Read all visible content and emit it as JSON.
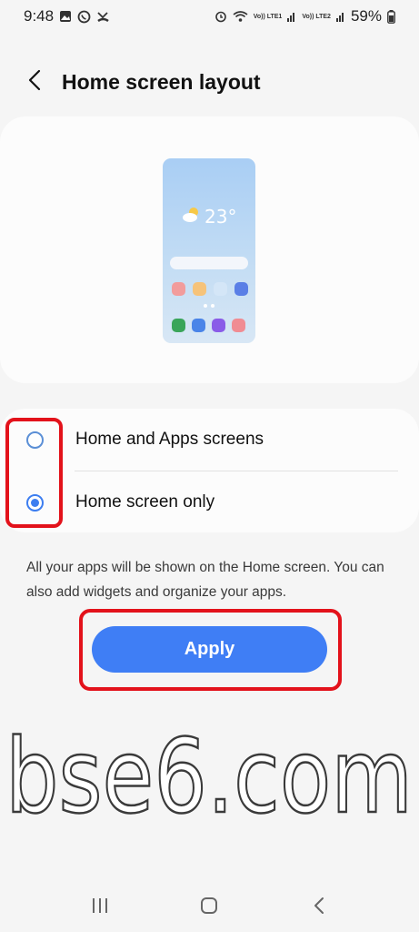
{
  "status_bar": {
    "time": "9:48",
    "battery": "59%",
    "sim1": "Vo)) LTE1",
    "sim2": "Vo)) LTE2",
    "icons": [
      "gallery-icon",
      "whatsapp-icon",
      "missed-call-icon",
      "alarm-icon",
      "wifi-icon",
      "signal-icon",
      "battery-icon"
    ]
  },
  "header": {
    "title": "Home screen layout",
    "back_icon": "chevron-left-icon"
  },
  "preview": {
    "temperature": "23°",
    "weather_icon": "partly-sunny-icon",
    "app_colors": [
      "#f29c9c",
      "#f6c37a",
      "#d4e6f7",
      "#5a7fe6"
    ],
    "dock_colors": [
      "#3aa55a",
      "#4a84e8",
      "#8a5ce8",
      "#f08c93"
    ]
  },
  "options": [
    {
      "label": "Home and Apps screens",
      "selected": false
    },
    {
      "label": "Home screen only",
      "selected": true
    }
  ],
  "description": "All your apps will be shown on the Home screen. You can also add widgets and organize your apps.",
  "apply_label": "Apply",
  "watermark": "bse6.com",
  "colors": {
    "accent": "#3f7ef5",
    "highlight": "#e3121b",
    "background": "#f5f5f5"
  },
  "nav_icons": [
    "recents-icon",
    "home-icon",
    "back-icon"
  ]
}
